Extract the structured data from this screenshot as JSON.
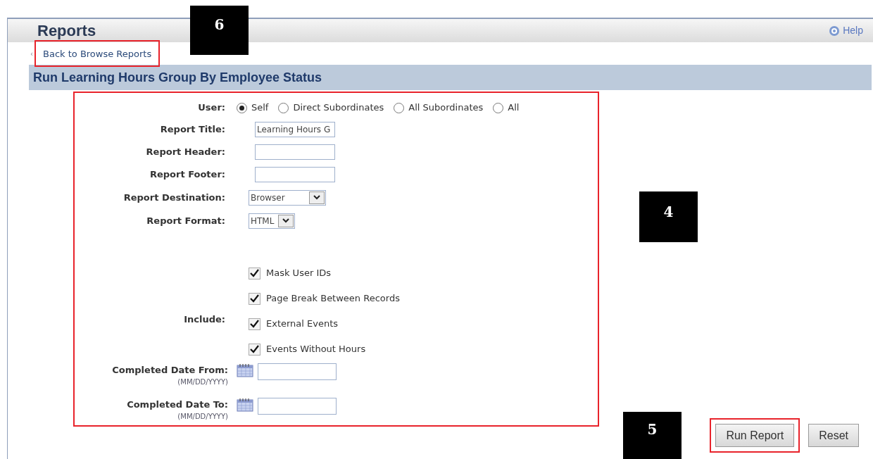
{
  "header": {
    "title": "Reports",
    "help": "Help"
  },
  "back_link": {
    "arrow": "‹",
    "label": "Back to Browse Reports",
    "highlighted": true
  },
  "section_title": "Run Learning Hours Group By Employee Status",
  "form": {
    "highlighted": true,
    "rows": [
      {
        "kind": "radio",
        "label": "User:",
        "options": [
          {
            "label": "Self",
            "selected": true
          },
          {
            "label": "Direct Subordinates",
            "selected": false
          },
          {
            "label": "All Subordinates",
            "selected": false
          },
          {
            "label": "All",
            "selected": false
          }
        ]
      },
      {
        "kind": "text",
        "label": "Report Title:",
        "value": "Learning Hours G"
      },
      {
        "kind": "text",
        "label": "Report Header:"
      },
      {
        "kind": "text",
        "label": "Report Footer:"
      },
      {
        "kind": "select",
        "label": "Report Destination:",
        "value": "Browser"
      },
      {
        "kind": "select",
        "label": "Report Format:",
        "value": "HTML"
      },
      {
        "kind": "checkboxes",
        "label": "Include:",
        "items": [
          {
            "label": "Mask User IDs",
            "checked": true
          },
          {
            "label": "Page Break Between Records",
            "checked": true
          },
          {
            "label": "External Events",
            "checked": true
          },
          {
            "label": "Events Without Hours",
            "checked": true
          }
        ]
      },
      {
        "kind": "date",
        "label": "Completed Date From:",
        "hint": "(MM/DD/YYYY)"
      },
      {
        "kind": "date",
        "label": "Completed Date To:",
        "hint": "(MM/DD/YYYY)"
      }
    ]
  },
  "buttons": [
    {
      "label": "Run Report",
      "highlighted": true
    },
    {
      "label": "Reset",
      "highlighted": false
    }
  ],
  "callouts": [
    {
      "label": "6"
    },
    {
      "label": "4"
    },
    {
      "label": "5"
    }
  ]
}
